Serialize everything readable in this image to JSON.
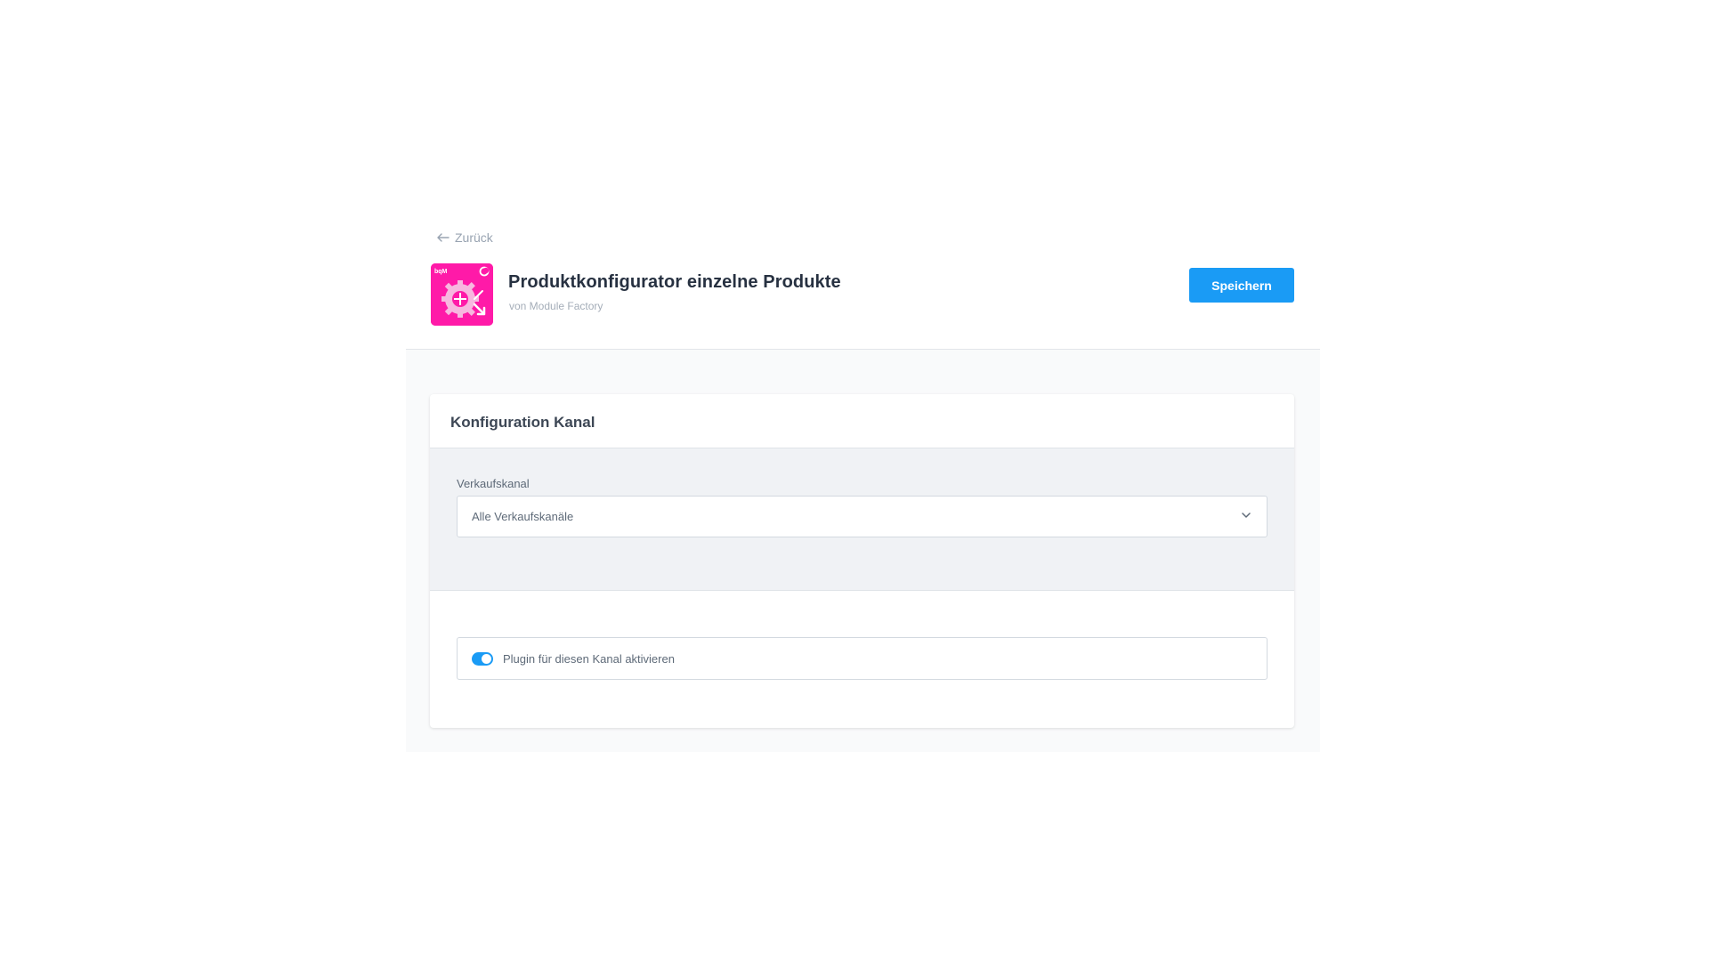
{
  "nav": {
    "back_label": "Zurück"
  },
  "header": {
    "title": "Produktkonfigurator einzelne Produkte",
    "vendor": "von Module Factory",
    "save_label": "Speichern",
    "icon_colors": {
      "background": "#ff1aa8",
      "foreground": "#ffffff"
    }
  },
  "card": {
    "title": "Konfiguration Kanal",
    "sales_channel": {
      "label": "Verkaufskanal",
      "selected": "Alle Verkaufskanäle"
    },
    "activate_toggle": {
      "label": "Plugin für diesen Kanal aktivieren",
      "checked": true
    }
  },
  "colors": {
    "accent": "#1a9bf5",
    "title_text": "#273141",
    "muted_text": "#98a3b1",
    "panel_gray": "#f0f2f5"
  }
}
